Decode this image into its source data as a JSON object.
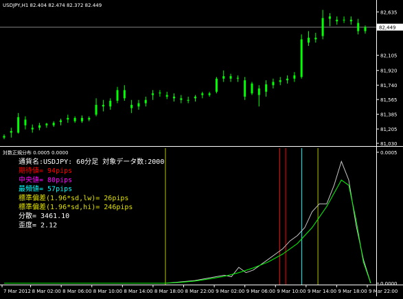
{
  "header": {
    "symbol_line": "USDJPY,H1  82.404 82.474 82.372 82.449",
    "current_price": "82,449"
  },
  "colors": {
    "background": "#000000",
    "candle": "#00ff00",
    "grid_border": "#ffffff",
    "dist_raw": "#c8c8c8",
    "dist_smooth": "#00ff00",
    "mean": "#ff0000",
    "median": "#ff00ff",
    "mode": "#00ffff",
    "std_band": "#b4c800"
  },
  "indicator": {
    "title": "対数正規分布 0.0005 0.0000",
    "scale_hi": "0.0005",
    "scale_lo": "0.0000",
    "lines": [
      {
        "text": "通貨名:USDJPY: 60分足 対象データ数:2000",
        "color": "#ffffff"
      },
      {
        "text": "期待値= 94pips",
        "color": "#ff0000"
      },
      {
        "text": "中央値= 80pips",
        "color": "#ff00ff"
      },
      {
        "text": "最頻値= 57pips",
        "color": "#00ffff"
      },
      {
        "text": "標準偏差(1.96*sd,lw)= 26pips",
        "color": "#e0e000"
      },
      {
        "text": "標準偏差(1.96*sd,hi)= 246pips",
        "color": "#e0e000"
      },
      {
        "text": "分散= 3461.10",
        "color": "#ffffff"
      },
      {
        "text": "歪度= 2.12",
        "color": "#ffffff"
      }
    ]
  },
  "chart_data": [
    {
      "type": "candlestick",
      "title": "USDJPY,H1",
      "y_ticks": [
        "82,635",
        "82,449",
        "82,105",
        "81,920",
        "81,740",
        "81,565",
        "81,385",
        "81,205",
        "81,030"
      ],
      "ylim": [
        81.03,
        82.68
      ],
      "current_price": 82.449,
      "bars": [
        {
          "o": 81.1,
          "h": 81.14,
          "l": 81.08,
          "c": 81.12
        },
        {
          "o": 81.18,
          "h": 81.22,
          "l": 81.1,
          "c": 81.16
        },
        {
          "o": 81.16,
          "h": 81.4,
          "l": 81.15,
          "c": 81.35
        },
        {
          "o": 81.32,
          "h": 81.36,
          "l": 81.2,
          "c": 81.25
        },
        {
          "o": 81.22,
          "h": 81.26,
          "l": 81.16,
          "c": 81.2
        },
        {
          "o": 81.22,
          "h": 81.28,
          "l": 81.19,
          "c": 81.25
        },
        {
          "o": 81.25,
          "h": 81.28,
          "l": 81.22,
          "c": 81.27
        },
        {
          "o": 81.25,
          "h": 81.3,
          "l": 81.23,
          "c": 81.28
        },
        {
          "o": 81.29,
          "h": 81.33,
          "l": 81.25,
          "c": 81.31
        },
        {
          "o": 81.32,
          "h": 81.38,
          "l": 81.28,
          "c": 81.34
        },
        {
          "o": 81.34,
          "h": 81.36,
          "l": 81.28,
          "c": 81.3
        },
        {
          "o": 81.3,
          "h": 81.37,
          "l": 81.28,
          "c": 81.34
        },
        {
          "o": 81.34,
          "h": 81.36,
          "l": 81.3,
          "c": 81.32
        },
        {
          "o": 81.38,
          "h": 81.58,
          "l": 81.36,
          "c": 81.5
        },
        {
          "o": 81.5,
          "h": 81.56,
          "l": 81.42,
          "c": 81.48
        },
        {
          "o": 81.48,
          "h": 81.58,
          "l": 81.44,
          "c": 81.55
        },
        {
          "o": 81.55,
          "h": 81.72,
          "l": 81.52,
          "c": 81.68
        },
        {
          "o": 81.68,
          "h": 81.74,
          "l": 81.55,
          "c": 81.58
        },
        {
          "o": 81.5,
          "h": 81.56,
          "l": 81.4,
          "c": 81.46
        },
        {
          "o": 81.48,
          "h": 81.56,
          "l": 81.44,
          "c": 81.52
        },
        {
          "o": 81.52,
          "h": 81.6,
          "l": 81.48,
          "c": 81.56
        },
        {
          "o": 81.62,
          "h": 81.68,
          "l": 81.56,
          "c": 81.64
        },
        {
          "o": 81.64,
          "h": 81.68,
          "l": 81.6,
          "c": 81.65
        },
        {
          "o": 81.62,
          "h": 81.66,
          "l": 81.57,
          "c": 81.6
        },
        {
          "o": 81.6,
          "h": 81.64,
          "l": 81.54,
          "c": 81.58
        },
        {
          "o": 81.56,
          "h": 81.62,
          "l": 81.52,
          "c": 81.58
        },
        {
          "o": 81.56,
          "h": 81.6,
          "l": 81.52,
          "c": 81.55
        },
        {
          "o": 81.58,
          "h": 81.62,
          "l": 81.54,
          "c": 81.6
        },
        {
          "o": 81.62,
          "h": 81.66,
          "l": 81.58,
          "c": 81.64
        },
        {
          "o": 81.64,
          "h": 81.66,
          "l": 81.6,
          "c": 81.62
        },
        {
          "o": 81.66,
          "h": 81.84,
          "l": 81.64,
          "c": 81.82
        },
        {
          "o": 81.82,
          "h": 81.92,
          "l": 81.78,
          "c": 81.85
        },
        {
          "o": 81.85,
          "h": 81.88,
          "l": 81.78,
          "c": 81.82
        },
        {
          "o": 81.82,
          "h": 81.86,
          "l": 81.78,
          "c": 81.83
        },
        {
          "o": 81.8,
          "h": 81.84,
          "l": 81.56,
          "c": 81.6
        },
        {
          "o": 81.64,
          "h": 81.78,
          "l": 81.62,
          "c": 81.76
        },
        {
          "o": 81.7,
          "h": 81.74,
          "l": 81.48,
          "c": 81.62
        },
        {
          "o": 81.66,
          "h": 81.8,
          "l": 81.6,
          "c": 81.75
        },
        {
          "o": 81.74,
          "h": 81.82,
          "l": 81.7,
          "c": 81.78
        },
        {
          "o": 81.78,
          "h": 81.84,
          "l": 81.74,
          "c": 81.8
        },
        {
          "o": 81.8,
          "h": 81.86,
          "l": 81.76,
          "c": 81.82
        },
        {
          "o": 81.82,
          "h": 81.9,
          "l": 81.78,
          "c": 81.86
        },
        {
          "o": 81.84,
          "h": 82.36,
          "l": 81.82,
          "c": 82.3
        },
        {
          "o": 82.32,
          "h": 82.4,
          "l": 82.22,
          "c": 82.26
        },
        {
          "o": 82.3,
          "h": 82.38,
          "l": 82.26,
          "c": 82.32
        },
        {
          "o": 82.34,
          "h": 82.66,
          "l": 82.3,
          "c": 82.56
        },
        {
          "o": 82.55,
          "h": 82.62,
          "l": 82.46,
          "c": 82.58
        },
        {
          "o": 82.54,
          "h": 82.58,
          "l": 82.48,
          "c": 82.52
        },
        {
          "o": 82.54,
          "h": 82.58,
          "l": 82.5,
          "c": 82.54
        },
        {
          "o": 82.54,
          "h": 82.58,
          "l": 82.48,
          "c": 82.52
        },
        {
          "o": 82.5,
          "h": 82.55,
          "l": 82.36,
          "c": 82.4
        },
        {
          "o": 82.4,
          "h": 82.47,
          "l": 82.37,
          "c": 82.45
        }
      ]
    },
    {
      "type": "line",
      "title": "対数正規分布",
      "ylim": [
        0,
        0.0005
      ],
      "x_ticks": [
        "7 Mar 2012",
        "8 Mar 02:00",
        "8 Mar 06:00",
        "8 Mar 10:00",
        "8 Mar 14:00",
        "8 Mar 18:00",
        "8 Mar 22:00",
        "9 Mar 02:00",
        "9 Mar 06:00",
        "9 Mar 10:00",
        "9 Mar 14:00",
        "9 Mar 18:00",
        "9 Mar 22:00"
      ],
      "x_range": [
        0,
        250
      ],
      "series": [
        {
          "style": "raw",
          "x": [
            0,
            20,
            40,
            60,
            80,
            100,
            110,
            120,
            130,
            140,
            150,
            155,
            160,
            165,
            170,
            175,
            180,
            185,
            190,
            195,
            200,
            205,
            210,
            215,
            220,
            225,
            230,
            235,
            240,
            245,
            250
          ],
          "y": [
            0.0,
            0.0,
            0.0,
            0.0,
            0.0,
            0.0,
            0.0,
            5e-06,
            1e-05,
            2e-05,
            3e-05,
            2.5e-05,
            6e-05,
            4e-05,
            5e-05,
            7e-05,
            9e-05,
            0.00011,
            0.00013,
            0.00016,
            0.00018,
            0.00021,
            0.00027,
            0.0003,
            0.0003,
            0.00037,
            0.00046,
            0.00039,
            0.00022,
            9e-05,
            0.0
          ]
        },
        {
          "style": "fit",
          "x": [
            0,
            20,
            40,
            60,
            80,
            100,
            110,
            120,
            130,
            140,
            150,
            160,
            170,
            180,
            190,
            200,
            210,
            220,
            225,
            230,
            235,
            240,
            245,
            250
          ],
          "y": [
            0.0,
            0.0,
            0.0,
            0.0,
            0.0,
            0.0,
            0.0,
            3e-06,
            8e-06,
            1.6e-05,
            2.6e-05,
            4e-05,
            5.8e-05,
            8e-05,
            0.00011,
            0.00015,
            0.00021,
            0.00029,
            0.00034,
            0.00039,
            0.00037,
            0.00024,
            8e-05,
            0.0
          ]
        }
      ],
      "vlines": [
        {
          "name": "std_lw",
          "x": 110
        },
        {
          "name": "mean",
          "x": 188
        },
        {
          "name": "median",
          "x": 192
        },
        {
          "name": "mode",
          "x": 203
        },
        {
          "name": "std_hi",
          "x": 214
        }
      ]
    }
  ],
  "right_axis_2": [
    "0.0005",
    "0.0000"
  ]
}
